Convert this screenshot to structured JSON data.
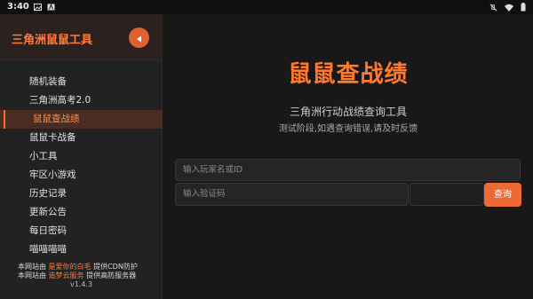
{
  "status_bar": {
    "time": "3:40",
    "left_icons": [
      "image-icon",
      "a-icon"
    ],
    "right_icons": [
      "mute-icon",
      "wifi-icon",
      "battery-icon"
    ]
  },
  "sidebar": {
    "title": "三角洲鼠鼠工具",
    "collapse_icon": "chevron-left-icon",
    "items": [
      {
        "label": "随机装备"
      },
      {
        "label": "三角洲高考2.0"
      },
      {
        "label": "鼠鼠查战绩",
        "active": true
      },
      {
        "label": "鼠鼠卡战备"
      },
      {
        "label": "小工具"
      },
      {
        "label": "牢区小游戏"
      },
      {
        "label": "历史记录"
      },
      {
        "label": "更新公告"
      },
      {
        "label": "每日密码"
      },
      {
        "label": "喵喵喵喵"
      }
    ],
    "footer": {
      "line1_prefix": "本网站由",
      "line1_highlight": "是爱你的白毛",
      "line1_suffix": "提供CDN防护",
      "line2_prefix": "本网站由",
      "line2_highlight": "造梦云服务",
      "line2_suffix": "提供高防服务器",
      "version": "v1.4.3"
    }
  },
  "main": {
    "title": "鼠鼠查战绩",
    "subtitle": "三角洲行动战绩查询工具",
    "notice": "测试阶段,如遇查询错误,请及时反馈",
    "player_placeholder": "输入玩家名或ID",
    "captcha_placeholder": "输入验证码",
    "query_label": "查询"
  },
  "colors": {
    "accent": "#ff7a2e",
    "button": "#ee6a35",
    "sidebar_bg": "#222222",
    "main_bg": "#181818"
  }
}
